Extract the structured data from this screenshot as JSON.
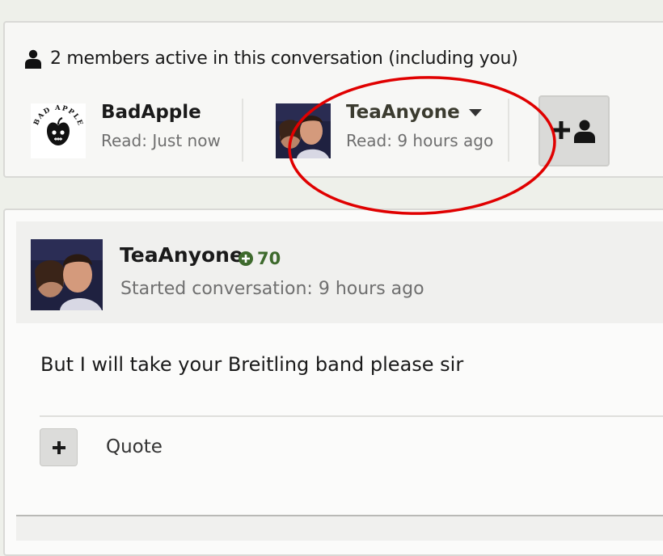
{
  "members_panel": {
    "heading": "2 members active in this conversation (including you)",
    "members": [
      {
        "name": "BadApple",
        "status": "Read: Just now",
        "avatar": "bad-apple-logo"
      },
      {
        "name": "TeaAnyone",
        "status": "Read: 9 hours ago",
        "avatar": "user-photo",
        "has_dropdown": true
      }
    ],
    "add_member_icon": "add-user-icon"
  },
  "message": {
    "author": "TeaAnyone",
    "reputation": "70",
    "meta": "Started conversation: 9 hours ago",
    "body": "But I will take your Breitling band please sir",
    "actions": {
      "quote_label": "Quote"
    }
  },
  "colors": {
    "highlight_circle": "#e00000",
    "reputation_green": "#3e6a2d",
    "muted_text": "#6f6f6f"
  }
}
